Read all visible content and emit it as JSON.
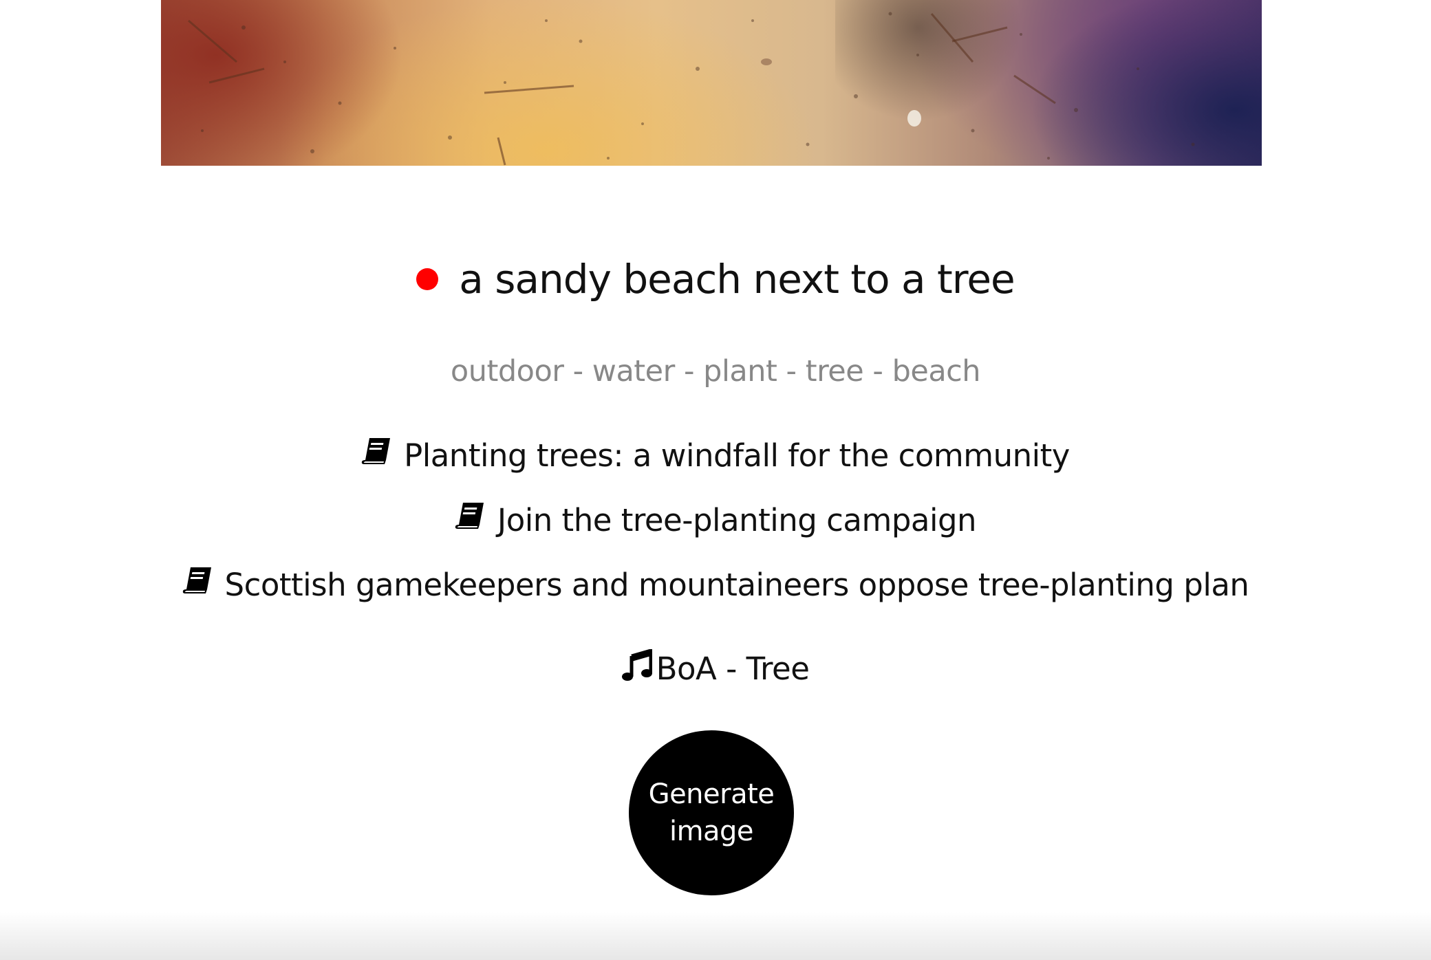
{
  "caption": {
    "status_color": "#ff0000",
    "text": "a sandy beach next to a tree"
  },
  "tags": "outdoor - water - plant - tree - beach",
  "articles": [
    {
      "icon": "book-icon",
      "title": "Planting trees: a windfall for the community"
    },
    {
      "icon": "book-icon",
      "title": "Join the tree-planting campaign"
    },
    {
      "icon": "book-icon",
      "title": "Scottish gamekeepers and mountaineers oppose tree-planting plan"
    }
  ],
  "song": {
    "icon": "music-note-icon",
    "title": "BoA - Tree"
  },
  "generate_button": {
    "label": "Generate image",
    "background": "#000000"
  }
}
